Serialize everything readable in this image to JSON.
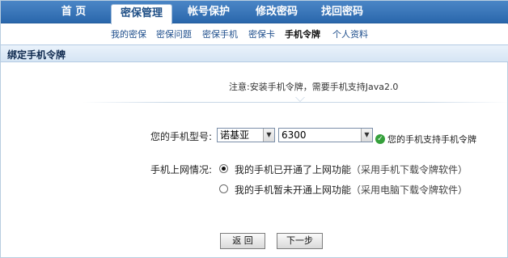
{
  "nav": {
    "items": [
      {
        "label": "首  页"
      },
      {
        "label": "密保管理"
      },
      {
        "label": "帐号保护"
      },
      {
        "label": "修改密码"
      },
      {
        "label": "找回密码"
      }
    ],
    "active_index": 1
  },
  "subnav": {
    "items": [
      {
        "label": "我的密保"
      },
      {
        "label": "密保问题"
      },
      {
        "label": "密保手机"
      },
      {
        "label": "密保卡"
      },
      {
        "label": "手机令牌"
      },
      {
        "label": "个人资料"
      }
    ],
    "active_index": 4
  },
  "section": {
    "title": "绑定手机令牌"
  },
  "notice": "注意:安装手机令牌，需要手机支持Java2.0",
  "form": {
    "phone_model_label": "您的手机型号:",
    "brand_value": "诺基亚",
    "model_value": "6300",
    "support_status": "您的手机支持手机令牌",
    "internet_label": "手机上网情况:",
    "options": [
      {
        "text": "我的手机已开通了上网功能",
        "hint": "（采用手机下载令牌软件）",
        "checked": true
      },
      {
        "text": "我的手机暂未开通上网功能",
        "hint": "（采用电脑下载令牌软件）",
        "checked": false
      }
    ]
  },
  "buttons": {
    "back": "返 回",
    "next": "下一步"
  },
  "colors": {
    "nav_bg": "#2a67ac",
    "section_bg": "#dce9f6",
    "success": "#35a03b"
  }
}
